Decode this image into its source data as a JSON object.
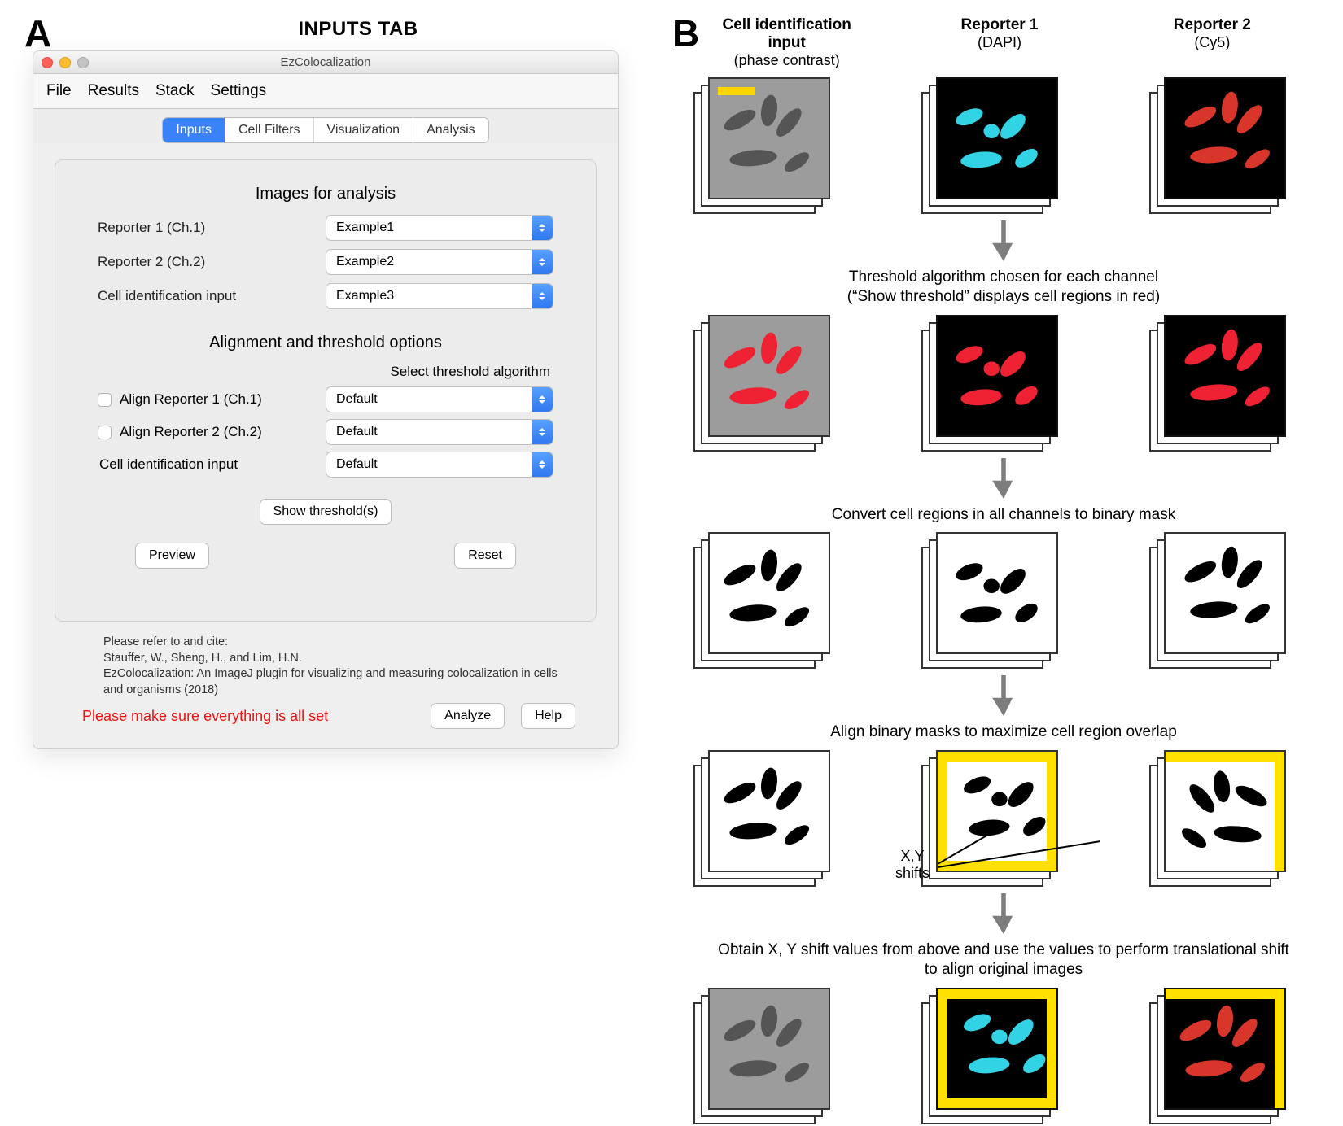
{
  "panelA": {
    "label": "A",
    "heading": "INPUTS TAB",
    "window_title": "EzColocalization",
    "menubar": [
      "File",
      "Results",
      "Stack",
      "Settings"
    ],
    "tabs": [
      "Inputs",
      "Cell Filters",
      "Visualization",
      "Analysis"
    ],
    "active_tab_index": 0,
    "images_section": "Images for analysis",
    "images": [
      {
        "label": "Reporter 1 (Ch.1)",
        "value": "Example1"
      },
      {
        "label": "Reporter 2 (Ch.2)",
        "value": "Example2"
      },
      {
        "label": "Cell identification input",
        "value": "Example3"
      }
    ],
    "align_section": "Alignment and threshold options",
    "align_sub": "Select threshold algorithm",
    "align_rows": [
      {
        "checkbox": true,
        "label": "Align Reporter 1 (Ch.1)",
        "value": "Default"
      },
      {
        "checkbox": true,
        "label": "Align Reporter 2 (Ch.2)",
        "value": "Default"
      },
      {
        "checkbox": false,
        "label": "Cell identification input",
        "value": "Default"
      }
    ],
    "show_threshold": "Show threshold(s)",
    "preview": "Preview",
    "reset": "Reset",
    "credits_lead": "Please refer to and cite:",
    "credits_authors": "Stauffer, W., Sheng, H., and Lim, H.N.",
    "credits_title": "EzColocalization: An ImageJ plugin for visualizing and measuring colocalization in cells and organisms (2018)",
    "warning": "Please make sure everything is all set",
    "analyze": "Analyze",
    "help": "Help"
  },
  "panelB": {
    "label": "B",
    "columns": [
      {
        "title": "Cell identification input",
        "subtitle": "(phase contrast)"
      },
      {
        "title": "Reporter 1",
        "subtitle": "(DAPI)"
      },
      {
        "title": "Reporter 2",
        "subtitle": "(Cy5)"
      }
    ],
    "steps": [
      "Threshold algorithm chosen for each channel\n(“Show threshold” displays cell regions in red)",
      "Convert cell regions in all channels to binary mask",
      "Align binary masks to maximize cell region overlap",
      "Obtain X, Y shift values from above and use the values to perform translational shift to align original images"
    ],
    "xy_shift_label": "X,Y\nshifts"
  }
}
